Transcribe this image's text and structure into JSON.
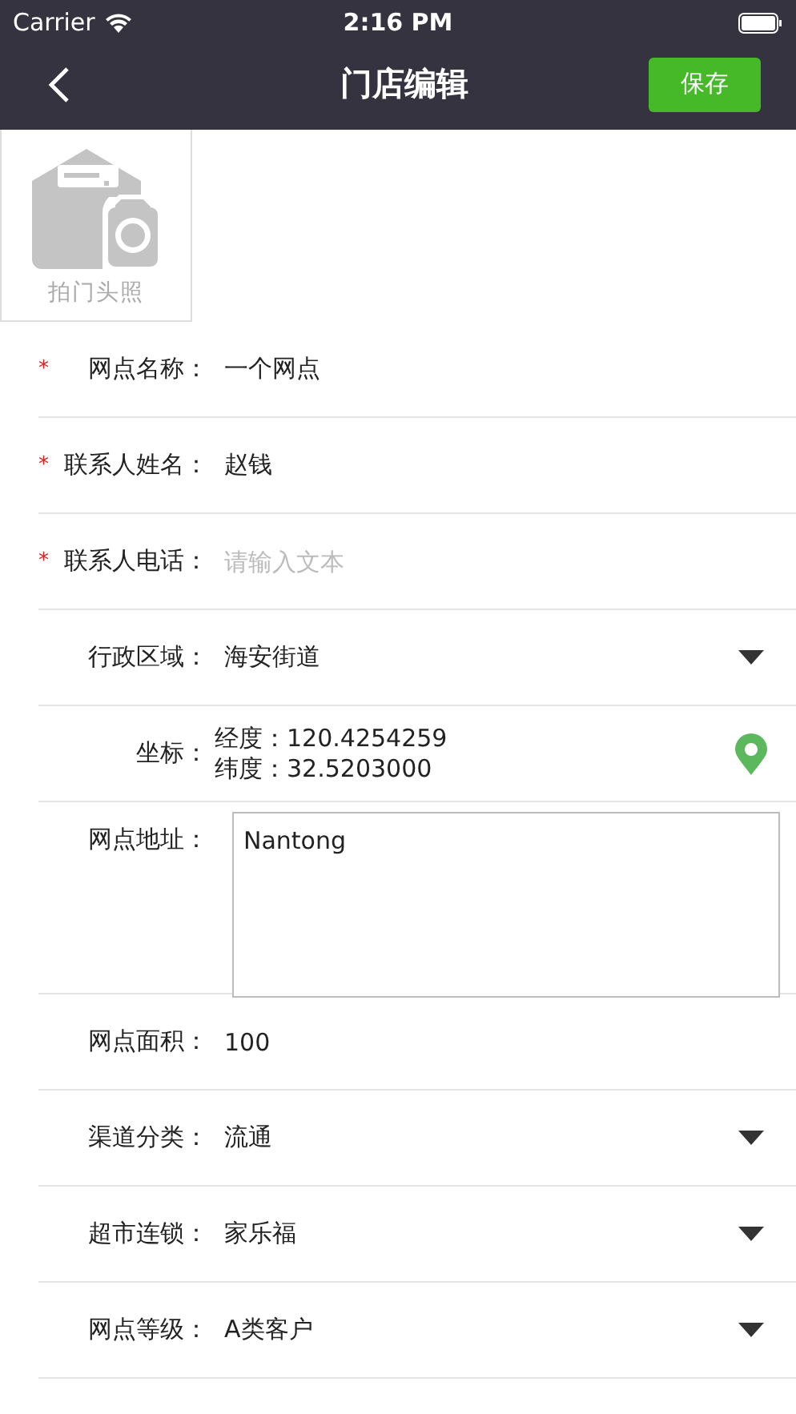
{
  "status_bar": {
    "carrier": "Carrier",
    "time": "2:16 PM"
  },
  "nav_bar": {
    "title": "门店编辑",
    "action": "保存"
  },
  "photo": {
    "caption": "拍门头照"
  },
  "fields": [
    {
      "kind": "text",
      "label": "网点名称：",
      "value": "一个网点",
      "required_mark": "*"
    },
    {
      "kind": "text",
      "label": "联系人姓名：",
      "value": "赵钱",
      "required_mark": "*"
    },
    {
      "kind": "text",
      "label": "联系人电话：",
      "placeholder": "请输入文本",
      "required_mark": "*"
    },
    {
      "kind": "select",
      "label": "行政区域：",
      "value": "海安街道"
    },
    {
      "kind": "coords",
      "label": "坐标：",
      "lines": [
        "经度：120.4254259",
        "纬度：32.5203000"
      ]
    },
    {
      "kind": "textarea",
      "label": "网点地址：",
      "value": "Nantong"
    },
    {
      "kind": "text",
      "label": "网点面积：",
      "value": "100"
    },
    {
      "kind": "select",
      "label": "渠道分类：",
      "value": "流通"
    },
    {
      "kind": "select",
      "label": "超市连锁：",
      "value": "家乐福"
    },
    {
      "kind": "select",
      "label": "网点等级：",
      "value": "A类客户"
    }
  ]
}
